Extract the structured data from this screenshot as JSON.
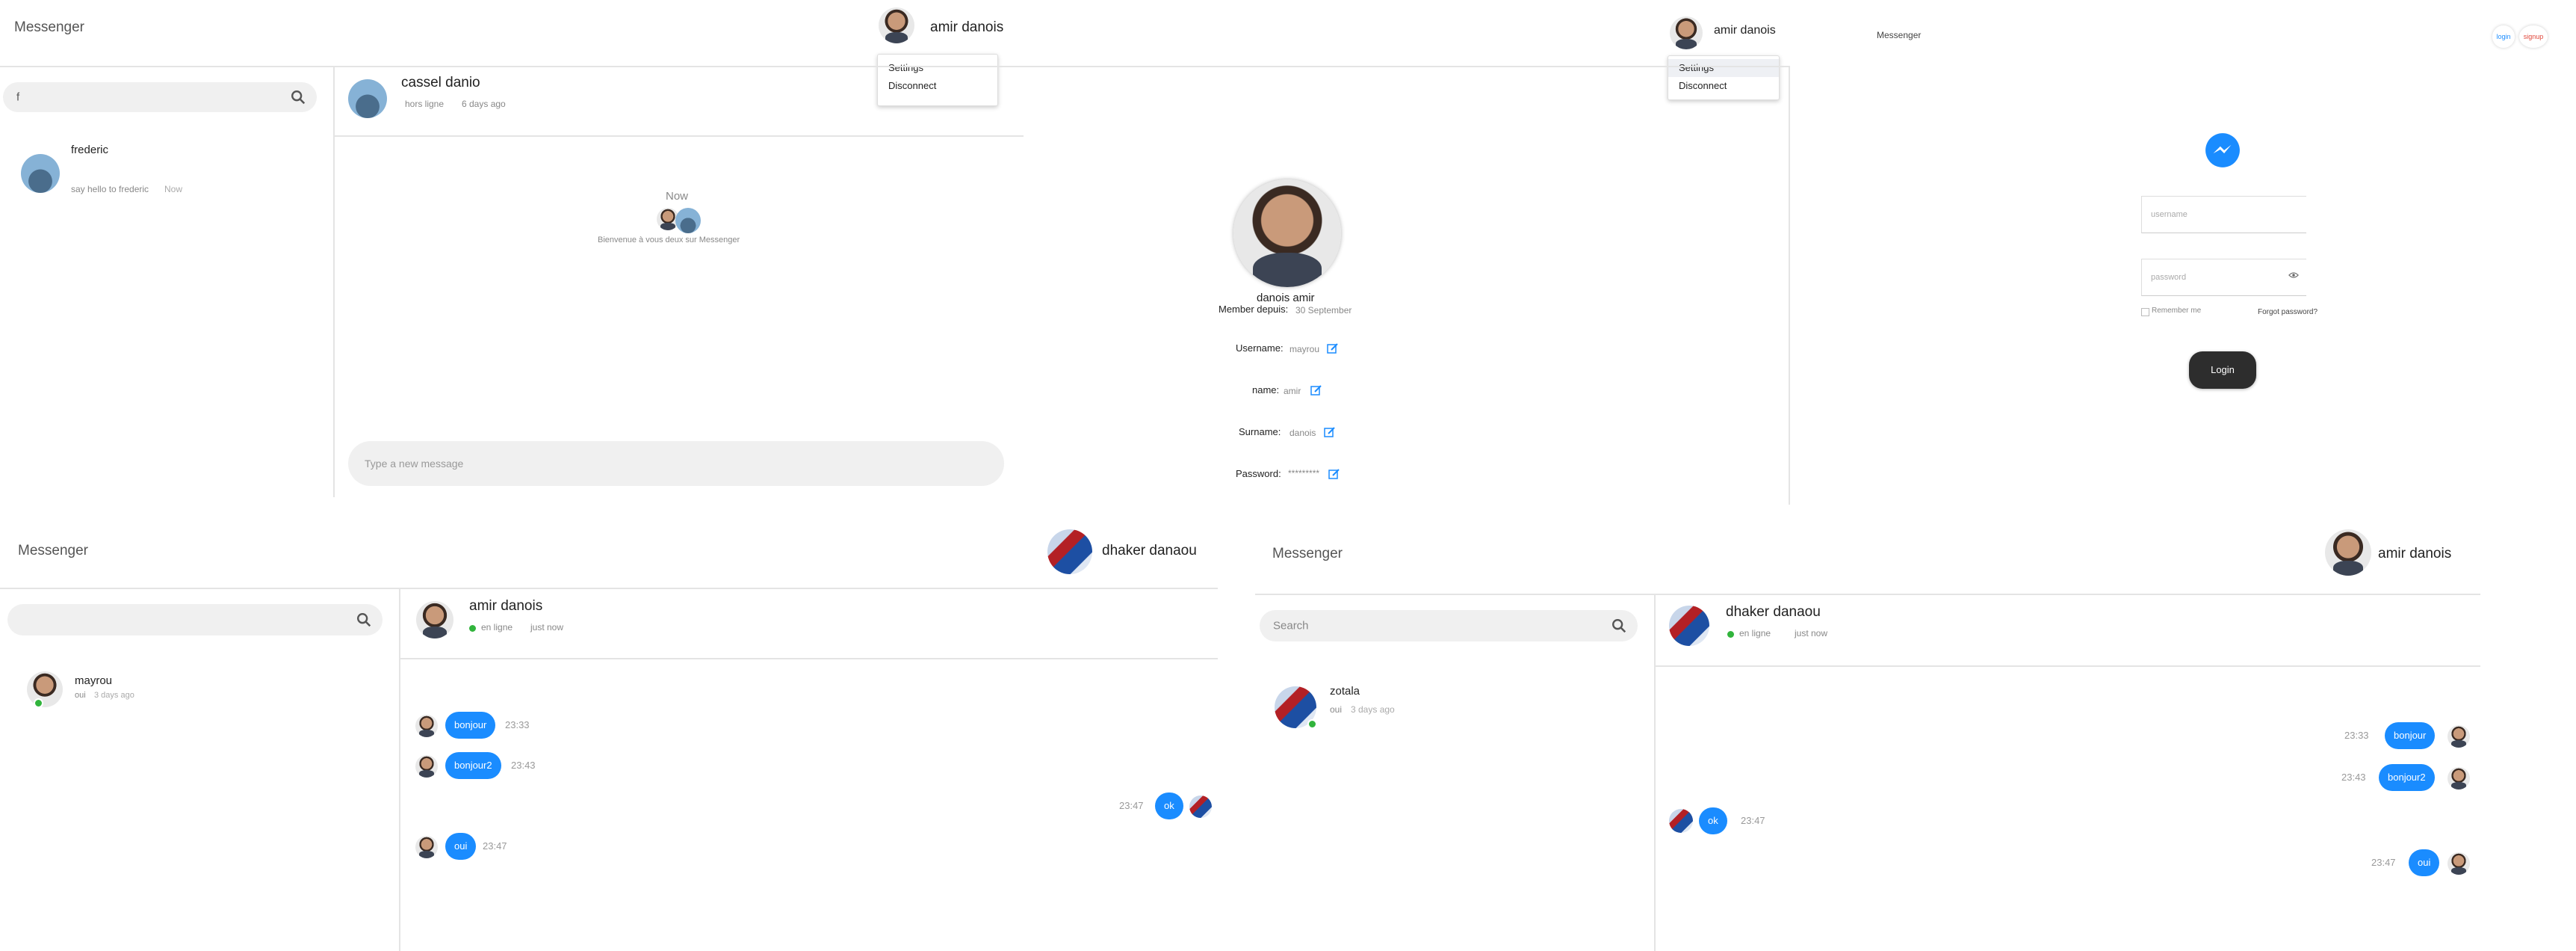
{
  "app_title": "Messenger",
  "s1": {
    "user": "amir danois",
    "menu": [
      "Settings",
      "Disconnect"
    ],
    "search_value": "f",
    "contacts": [
      {
        "name": "frederic",
        "last": "say hello to frederic",
        "time": "Now"
      }
    ],
    "chat": {
      "name": "cassel danio",
      "status": "hors ligne",
      "seen": "6 days ago",
      "day": "Now",
      "welcome": "Bienvenue à vous deux sur Messenger",
      "input_placeholder": "Type a new message"
    }
  },
  "s2": {
    "user": "amir danois",
    "menu": [
      "Settings",
      "Disconnect"
    ],
    "profile": {
      "fullname": "danois amir",
      "member_label": "Member depuis:",
      "member_value": "30 September",
      "fields": [
        {
          "label": "Username:",
          "value": "mayrou"
        },
        {
          "label": "name:",
          "value": "amir"
        },
        {
          "label": "Surname:",
          "value": "danois"
        },
        {
          "label": "Password:",
          "value": "*********"
        }
      ]
    }
  },
  "s3": {
    "title": "Messenger",
    "btn_login": "login",
    "btn_signup": "signup",
    "username_ph": "username",
    "password_ph": "password",
    "remember": "Remember me",
    "forgot": "Forgot password?",
    "submit": "Login"
  },
  "s4": {
    "user": "dhaker danaou",
    "contacts": [
      {
        "name": "mayrou",
        "last": "oui",
        "time": "3 days ago"
      }
    ],
    "chat": {
      "name": "amir danois",
      "status": "en ligne",
      "seen": "just now",
      "messages": [
        {
          "text": "bonjour",
          "time": "23:33"
        },
        {
          "text": "bonjour2",
          "time": "23:43"
        },
        {
          "text": "ok",
          "time": "23:47"
        },
        {
          "text": "oui",
          "time": "23:47"
        }
      ]
    }
  },
  "s5": {
    "user": "amir danois",
    "search_placeholder": "Search",
    "contacts": [
      {
        "name": "zotala",
        "last": "oui",
        "time": "3 days ago"
      }
    ],
    "chat": {
      "name": "dhaker danaou",
      "status": "en ligne",
      "seen": "just now",
      "messages": [
        {
          "text": "bonjour",
          "time": "23:33"
        },
        {
          "text": "bonjour2",
          "time": "23:43"
        },
        {
          "text": "ok",
          "time": "23:47"
        },
        {
          "text": "oui",
          "time": "23:47"
        }
      ]
    }
  },
  "colors": {
    "accent": "#1a8cff",
    "online": "#31b43c",
    "login_button": "#2d2d2d"
  }
}
